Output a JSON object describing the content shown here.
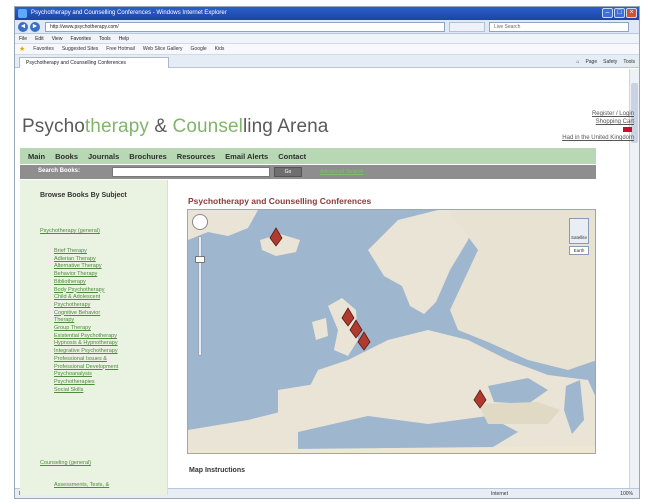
{
  "browser": {
    "window_title": "Psychotherapy and Counselling Conferences - Windows Internet Explorer",
    "address": "http://www.psychotherapy.com/",
    "search_placeholder": "Live Search",
    "menu": [
      "File",
      "Edit",
      "View",
      "Favorites",
      "Tools",
      "Help"
    ],
    "favorites": [
      "Favorites",
      "Suggested Sites",
      "Free Hotmail",
      "Web Slice Gallery",
      "Google",
      "Kids"
    ],
    "tab_title": "Psychotherapy and Counselling Conferences",
    "commands": [
      "Page",
      "Safety",
      "Tools"
    ],
    "status_done": "Done",
    "status_zone": "Internet",
    "status_zoom": "100%"
  },
  "site": {
    "title_parts": [
      "Psycho",
      "therapy",
      " & ",
      "Counsel",
      "ling",
      " Arena"
    ],
    "header_links": [
      "Register / Login",
      "Shopping Cart",
      "Had in the United Kingdom"
    ],
    "nav": [
      "Main",
      "Books",
      "Journals",
      "Brochures",
      "Resources",
      "Email Alerts",
      "Contact"
    ],
    "search": {
      "label": "Search Books:",
      "button": "Go",
      "advanced": "Advanced Search"
    }
  },
  "sidebar": {
    "title": "Browse Books By Subject",
    "category_1": "Psychotherapy (general)",
    "items": [
      "Brief Therapy",
      "Adlerian Therapy",
      "Alternative Therapy",
      "Behavior Therapy",
      "Bibliotherapy",
      "Body Psychotherapy",
      "Child & Adolescent",
      "Psychotherapy",
      "Cognitive Behavior",
      "Therapy",
      "Group Therapy",
      "Existential Psychotherapy",
      "Hypnosis & Hypnotherapy",
      "Integrative Psychotherapy",
      "Professional Issues &",
      "Professional Development",
      "Psychoanalysis",
      "Psychotherapies",
      "Social Skills"
    ],
    "category_2": "Counseling (general)",
    "category_3": "Assessments, Tests, &"
  },
  "content": {
    "heading": "Psychotherapy and Counselling Conferences",
    "map_type": "Satellite",
    "map_terrain": "Earth",
    "map_instructions": "Map Instructions"
  },
  "colors": {
    "accent_green": "#7fb66a",
    "nav_green": "#b8d8b5",
    "title_red": "#8a3a3a",
    "sea": "#9fb6cf",
    "land": "#eae4d6"
  }
}
